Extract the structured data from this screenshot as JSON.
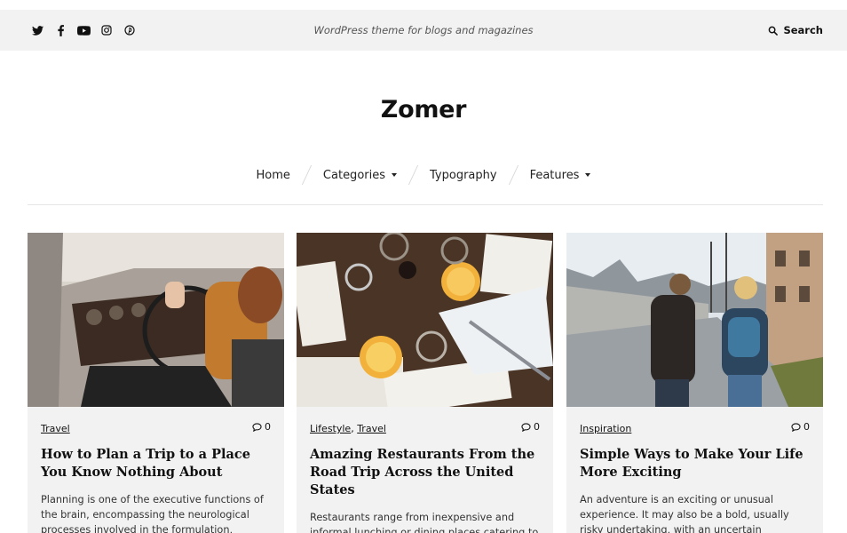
{
  "topbar": {
    "social": [
      {
        "icon": "twitter-icon"
      },
      {
        "icon": "facebook-icon"
      },
      {
        "icon": "youtube-icon"
      },
      {
        "icon": "instagram-icon"
      },
      {
        "icon": "pinterest-icon"
      }
    ],
    "tagline": "WordPress theme for blogs and magazines",
    "search_label": "Search"
  },
  "site": {
    "title": "Zomer"
  },
  "nav": {
    "items": [
      {
        "label": "Home"
      },
      {
        "label": "Categories",
        "has_dropdown": true
      },
      {
        "label": "Typography"
      },
      {
        "label": "Features",
        "has_dropdown": true
      }
    ]
  },
  "posts": [
    {
      "categories": [
        "Travel"
      ],
      "comment_count": "0",
      "title": "How to Plan a Trip to a Place You Know Nothing About",
      "excerpt": "Planning is one of the executive functions of the brain, encompassing the neurological processes involved in the formulation, evaluation and",
      "image": "woman-driving-car-photo"
    },
    {
      "categories": [
        "Lifestyle",
        "Travel"
      ],
      "comment_count": "0",
      "title": "Amazing Restaurants From the Road Trip Across the United States",
      "excerpt": "Restaurants range from inexpensive and informal lunching or dining places catering to people",
      "image": "restaurant-table-photo"
    },
    {
      "categories": [
        "Inspiration"
      ],
      "comment_count": "0",
      "title": "Simple Ways to Make Your Life More Exciting",
      "excerpt": "An adventure is an exciting or unusual experience. It may also be a bold, usually risky undertaking, with an uncertain outcome. The term also broadly",
      "image": "couple-walking-street-photo"
    }
  ]
}
